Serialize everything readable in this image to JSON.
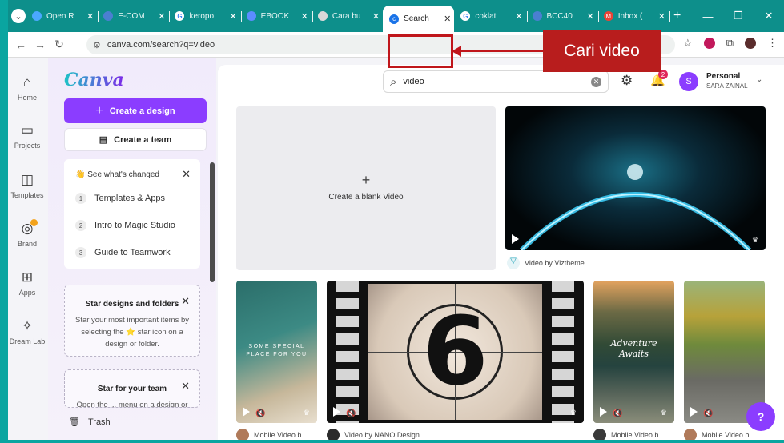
{
  "browser": {
    "tabs": [
      {
        "title": "Open R",
        "fav_color": "#4aa8ff"
      },
      {
        "title": "E-COM",
        "fav_color": "#4a7fd1"
      },
      {
        "title": "keropo",
        "fav_color": "#ffffff"
      },
      {
        "title": "EBOOK",
        "fav_color": "#5b8cff"
      },
      {
        "title": "Cara bu",
        "fav_color": "#d9d9d9"
      },
      {
        "title": "Search",
        "fav_color": "#1a73e8",
        "active": true
      },
      {
        "title": "coklat",
        "fav_color": "#ffffff"
      },
      {
        "title": "BCC40",
        "fav_color": "#4a7fd1"
      },
      {
        "title": "Inbox (",
        "fav_color": "#ea4335"
      }
    ],
    "new_tab": "+",
    "url": "canva.com/search?q=video"
  },
  "annotation": {
    "label": "Cari video"
  },
  "rail": {
    "items": [
      {
        "label": "Home",
        "icon": "home-icon",
        "glyph": "⌂"
      },
      {
        "label": "Projects",
        "icon": "folder-icon",
        "glyph": "▭"
      },
      {
        "label": "Templates",
        "icon": "templates-icon",
        "glyph": "◫"
      },
      {
        "label": "Brand",
        "icon": "brand-icon",
        "glyph": "◎"
      },
      {
        "label": "Apps",
        "icon": "apps-icon",
        "glyph": "⊞"
      },
      {
        "label": "Dream Lab",
        "icon": "dream-lab-icon",
        "glyph": "✧"
      }
    ]
  },
  "panel": {
    "logo": "Canva",
    "create_design": "Create a design",
    "create_team": "Create a team",
    "whats_new": {
      "title": "See what's changed",
      "items": [
        {
          "num": "1",
          "label": "Templates & Apps"
        },
        {
          "num": "2",
          "label": "Intro to Magic Studio"
        },
        {
          "num": "3",
          "label": "Guide to Teamwork"
        }
      ]
    },
    "star_designs": {
      "title": "Star designs and folders",
      "body": "Star your most important items by selecting the ⭐ star icon on a design or folder."
    },
    "star_team": {
      "title": "Star for your team",
      "body": "Open the ... menu on a design or"
    },
    "trash": "Trash"
  },
  "topbar": {
    "search_value": "video",
    "notification_count": "2",
    "avatar_initial": "S",
    "account_type": "Personal",
    "account_name": "SARA ZAINAL"
  },
  "results": {
    "blank_label": "Create a blank Video",
    "featured_caption": "Video by Viztheme",
    "thumb_texts": {
      "sea": "SOME SPECIAL PLACE FOR YOU",
      "countdown": "6",
      "adventure": "Adventure Awaits"
    },
    "captions": [
      "Mobile Video b...",
      "Video by NANO Design",
      "Mobile Video b...",
      "Mobile Video b..."
    ]
  },
  "help_label": "?"
}
